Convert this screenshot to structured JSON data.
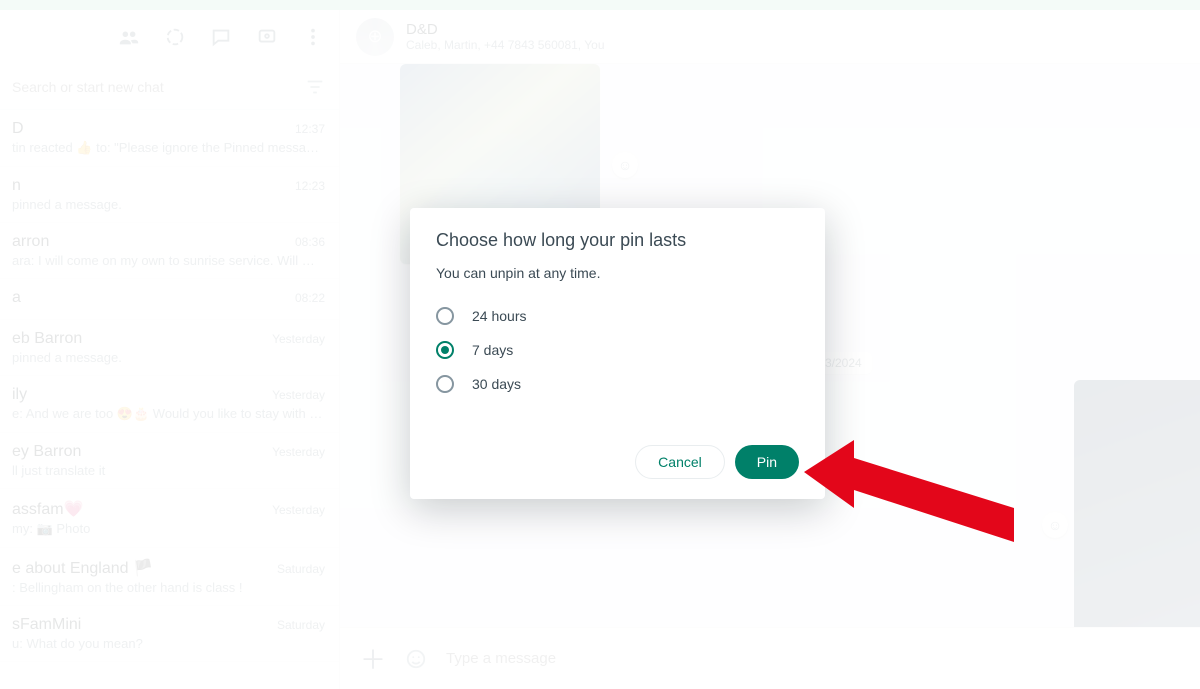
{
  "left": {
    "header_icons": [
      "groups-icon",
      "status-icon",
      "chat-new-icon",
      "channels-icon",
      "menu-icon"
    ],
    "search_placeholder": "Search or start new chat",
    "chats": [
      {
        "name": "D",
        "time": "12:37",
        "msg": "tin reacted 👍 to: \"Please ignore the Pinned message noti..."
      },
      {
        "name": "n",
        "time": "12:23",
        "msg": "pinned a message."
      },
      {
        "name": "arron",
        "time": "08:36",
        "msg": "ara: I will come on my own to sunrise service. Will my cloc..."
      },
      {
        "name": "a",
        "time": "08:22",
        "msg": ""
      },
      {
        "name": "eb Barron",
        "time": "Yesterday",
        "msg": "pinned a message."
      },
      {
        "name": "ily",
        "time": "Yesterday",
        "msg": "e: And we are too 😍🎂 Would you like to stay with us for..."
      },
      {
        "name": "ey Barron",
        "time": "Yesterday",
        "msg": "ll just translate it"
      },
      {
        "name": "assfam💗",
        "time": "Yesterday",
        "msg": "my: 📷 Photo"
      },
      {
        "name": "e about England 🏴",
        "time": "Saturday",
        "msg": ": Bellingham on the other hand is class !"
      },
      {
        "name": "sFamMini",
        "time": "Saturday",
        "msg": "u: What do you mean?"
      }
    ]
  },
  "chat_header": {
    "title": "D&D",
    "subtitle": "Caleb, Martin, +44 7843 560081, You"
  },
  "conversation": {
    "date_chip": "3/2024",
    "compose_placeholder": "Type a message"
  },
  "modal": {
    "title": "Choose how long your pin lasts",
    "subtitle": "You can unpin at any time.",
    "options": [
      {
        "label": "24 hours",
        "selected": false
      },
      {
        "label": "7 days",
        "selected": true
      },
      {
        "label": "30 days",
        "selected": false
      }
    ],
    "cancel": "Cancel",
    "confirm": "Pin"
  }
}
